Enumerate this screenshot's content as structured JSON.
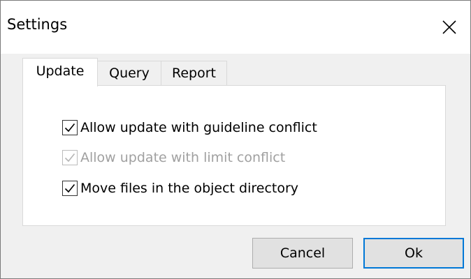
{
  "window": {
    "title": "Settings",
    "close_icon": "close-icon"
  },
  "tabs": [
    {
      "label": "Update",
      "active": true
    },
    {
      "label": "Query",
      "active": false
    },
    {
      "label": "Report",
      "active": false
    }
  ],
  "update_tab": {
    "options": [
      {
        "label": "Allow update with guideline conflict",
        "checked": true,
        "enabled": true
      },
      {
        "label": "Allow update with limit conflict",
        "checked": true,
        "enabled": false
      },
      {
        "label": "Move files in the object directory",
        "checked": true,
        "enabled": true
      }
    ]
  },
  "buttons": {
    "cancel_label": "Cancel",
    "ok_label": "Ok"
  },
  "colors": {
    "default_button_border": "#0078d7",
    "disabled_text": "#a0a0a0",
    "check_mark": "#000000",
    "check_mark_disabled": "#b5b5b5"
  }
}
